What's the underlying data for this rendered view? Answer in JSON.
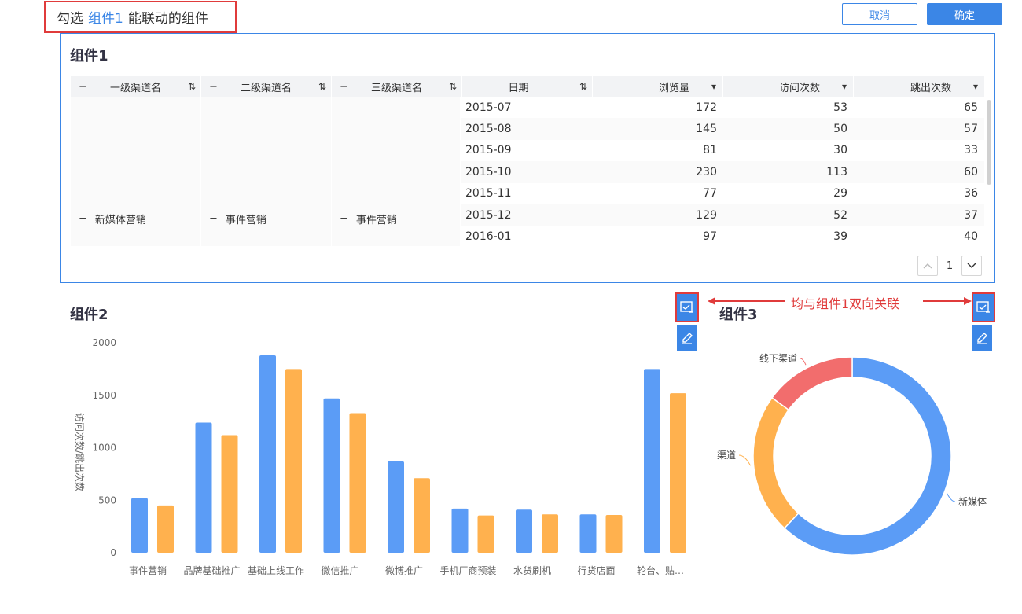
{
  "header": {
    "prefix": "勾选",
    "highlight": "组件1",
    "suffix": "能联动的组件",
    "cancel_label": "取消",
    "ok_label": "确定"
  },
  "comp1": {
    "title": "组件1",
    "columns": [
      {
        "label": "一级渠道名",
        "icon": "sort-filter-icon"
      },
      {
        "label": "二级渠道名",
        "icon": "sort-icon"
      },
      {
        "label": "三级渠道名",
        "icon": "sort-icon"
      },
      {
        "label": "日期",
        "icon": "sort-icon"
      },
      {
        "label": "浏览量",
        "icon": "dropdown-icon"
      },
      {
        "label": "访问次数",
        "icon": "dropdown-icon"
      },
      {
        "label": "跳出次数",
        "icon": "dropdown-icon"
      }
    ],
    "merged": [
      "新媒体营销",
      "事件营销",
      "事件营销"
    ],
    "rows": [
      {
        "date": "2015-07",
        "views": "172",
        "visits": "53",
        "bounces": "65"
      },
      {
        "date": "2015-08",
        "views": "145",
        "visits": "50",
        "bounces": "57"
      },
      {
        "date": "2015-09",
        "views": "81",
        "visits": "30",
        "bounces": "33"
      },
      {
        "date": "2015-10",
        "views": "230",
        "visits": "113",
        "bounces": "60"
      },
      {
        "date": "2015-11",
        "views": "77",
        "visits": "29",
        "bounces": "36"
      },
      {
        "date": "2015-12",
        "views": "129",
        "visits": "52",
        "bounces": "37"
      },
      {
        "date": "2016-01",
        "views": "97",
        "visits": "39",
        "bounces": "40"
      }
    ],
    "page": "1"
  },
  "comp2": {
    "title": "组件2"
  },
  "comp3": {
    "title": "组件3"
  },
  "annotation": "均与组件1双向关联",
  "colors": {
    "accent": "#3b86e6",
    "blue_series": "#5b9cf6",
    "orange_series": "#ffb14e",
    "red_slice": "#f26d6d",
    "annotation": "#e03b3b"
  },
  "chart_data": [
    {
      "type": "bar",
      "ylabel": "访问次数/跳出次数",
      "ylim": [
        0,
        2000
      ],
      "yticks": [
        "0",
        "500",
        "1000",
        "1500",
        "2000"
      ],
      "categories": [
        "事件营销",
        "品牌基础推广",
        "基础上线工作",
        "微信推广",
        "微博推广",
        "手机厂商预装",
        "水货刷机",
        "行货店面",
        "轮台、贴…"
      ],
      "series": [
        {
          "values": [
            520,
            1240,
            1880,
            1470,
            870,
            420,
            410,
            365,
            1750
          ]
        },
        {
          "values": [
            450,
            1120,
            1750,
            1330,
            710,
            355,
            365,
            360,
            1520
          ]
        }
      ],
      "grid": false
    },
    {
      "type": "pie",
      "categories": [
        "新媒体",
        "渠道",
        "线下渠道"
      ],
      "values": [
        62,
        23,
        15
      ]
    }
  ]
}
